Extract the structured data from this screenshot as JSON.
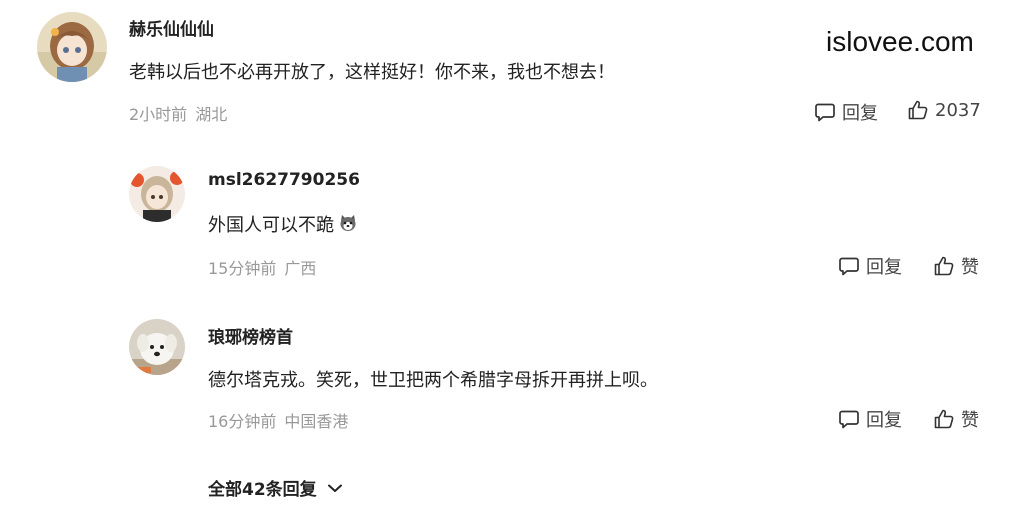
{
  "watermark": "islovee.com",
  "comments": [
    {
      "username": "赫乐仙仙仙",
      "content": "老韩以后也不必再开放了，这样挺好！你不来，我也不想去！",
      "time": "2小时前",
      "location": "湖北",
      "reply_label": "回复",
      "like_label": "2037"
    },
    {
      "username": "msl2627790256",
      "content": "外国人可以不跪",
      "emoji_icon": "husky-dog-emoji",
      "time": "15分钟前",
      "location": "广西",
      "reply_label": "回复",
      "like_label": "赞"
    },
    {
      "username": "琅琊榜榜首",
      "content": "德尔塔克戎。笑死，世卫把两个希腊字母拆开再拼上呗。",
      "time": "16分钟前",
      "location": "中国香港",
      "reply_label": "回复",
      "like_label": "赞"
    }
  ],
  "expand_replies_label": "全部42条回复",
  "icons": {
    "reply": "comment-bubble-icon",
    "like": "thumbs-up-icon",
    "expand": "chevron-down-icon"
  }
}
